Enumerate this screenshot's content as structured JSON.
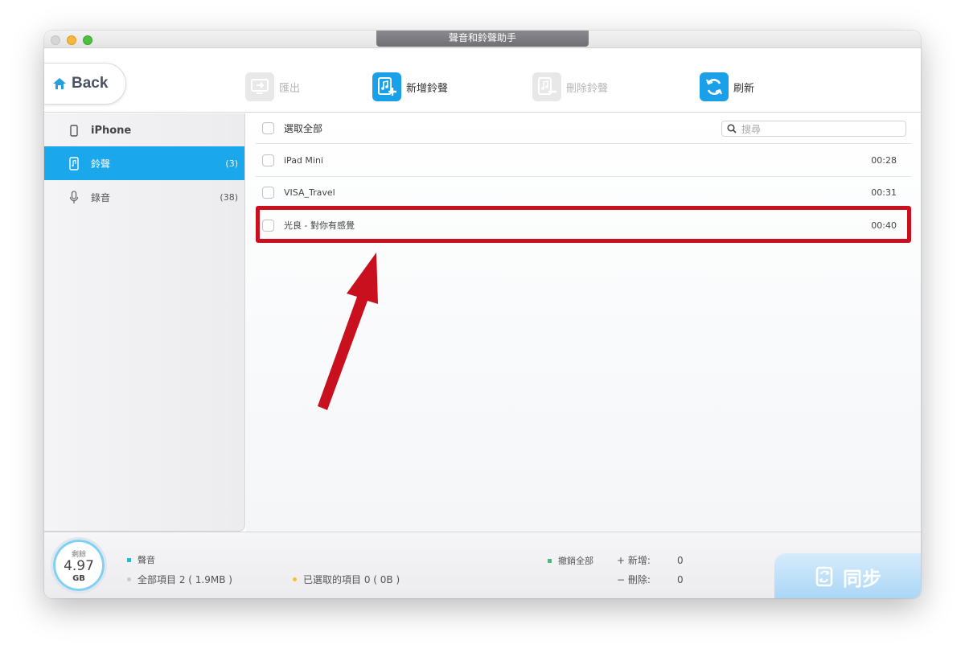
{
  "window": {
    "title": "聲音和鈴聲助手"
  },
  "toolbar": {
    "back_label": "Back",
    "export_label": "匯出",
    "add_label": "新增鈴聲",
    "delete_label": "刪除鈴聲",
    "refresh_label": "刷新"
  },
  "sidebar": {
    "device": "iPhone",
    "items": [
      {
        "label": "鈴聲",
        "count": "(3)"
      },
      {
        "label": "錄音",
        "count": "(38)"
      }
    ]
  },
  "list": {
    "select_all": "選取全部",
    "search_placeholder": "搜尋",
    "rows": [
      {
        "name": "iPad Mini",
        "duration": "00:28"
      },
      {
        "name": "VISA_Travel",
        "duration": "00:31"
      },
      {
        "name": "光良 - 對你有感覺",
        "duration": "00:40"
      }
    ]
  },
  "bottom": {
    "gauge_label": "剩餘",
    "gauge_value": "4.97",
    "gauge_unit": "GB",
    "category": "聲音",
    "total_items": "全部項目 2 ( 1.9MB )",
    "selected_items": "已選取的項目 0 ( 0B )",
    "undo_all": "撤銷全部",
    "add_label": "+ 新增:",
    "add_count": "0",
    "delete_label": "− 刪除:",
    "delete_count": "0",
    "sync_label": "同步"
  },
  "colors": {
    "accent": "#1aa7ec",
    "highlight": "#c8101e",
    "category_dot": "#2bb7d9",
    "selected_dot": "#f5c02e",
    "undo_dot": "#3cc07a"
  }
}
